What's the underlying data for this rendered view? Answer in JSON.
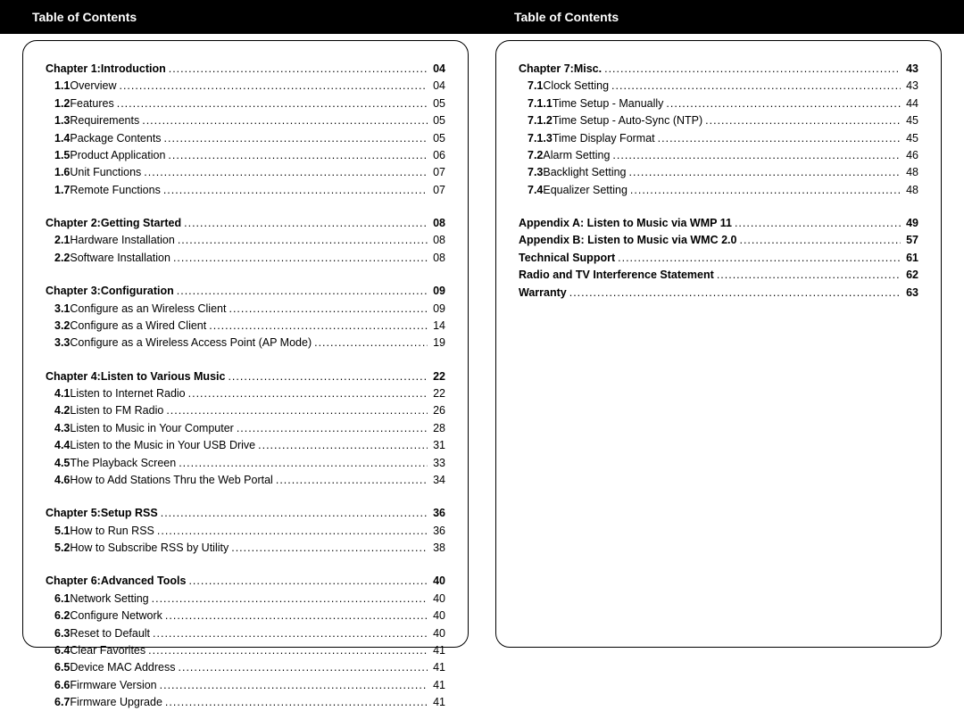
{
  "header_left": "Table of Contents",
  "header_right": "Table of Contents",
  "left_sections": [
    {
      "head": {
        "lead": "Chapter 1:",
        "title": "Introduction",
        "page": "04"
      },
      "rows": [
        {
          "lead": "1.1",
          "title": "Overview",
          "page": "04"
        },
        {
          "lead": "1.2",
          "title": "Features",
          "page": "05"
        },
        {
          "lead": "1.3",
          "title": "Requirements",
          "page": "05"
        },
        {
          "lead": "1.4",
          "title": "Package Contents",
          "page": "05"
        },
        {
          "lead": "1.5",
          "title": "Product Application",
          "page": "06"
        },
        {
          "lead": "1.6",
          "title": "Unit Functions",
          "page": "07"
        },
        {
          "lead": "1.7",
          "title": "Remote Functions",
          "page": "07"
        }
      ]
    },
    {
      "head": {
        "lead": "Chapter 2:",
        "title": "Getting Started",
        "page": "08"
      },
      "rows": [
        {
          "lead": "2.1",
          "title": "Hardware Installation",
          "page": "08"
        },
        {
          "lead": "2.2",
          "title": "Software Installation",
          "page": "08"
        }
      ]
    },
    {
      "head": {
        "lead": "Chapter 3:",
        "title": "Configuration",
        "page": "09"
      },
      "rows": [
        {
          "lead": "3.1",
          "title": "Configure as an Wireless Client",
          "page": "09"
        },
        {
          "lead": "3.2",
          "title": "Configure as a Wired Client",
          "page": "14"
        },
        {
          "lead": "3.3",
          "title": "Configure as a Wireless Access Point (AP Mode)",
          "page": "19"
        }
      ]
    },
    {
      "head": {
        "lead": "Chapter 4:",
        "title": "Listen to Various Music",
        "page": "22"
      },
      "rows": [
        {
          "lead": "4.1",
          "title": "Listen to Internet Radio",
          "page": "22"
        },
        {
          "lead": "4.2",
          "title": "Listen to FM Radio",
          "page": "26"
        },
        {
          "lead": "4.3",
          "title": "Listen to Music in Your Computer",
          "page": "28"
        },
        {
          "lead": "4.4",
          "title": "Listen to the Music in Your USB Drive",
          "page": "31"
        },
        {
          "lead": "4.5",
          "title": "The Playback Screen",
          "page": "33"
        },
        {
          "lead": "4.6",
          "title": "How to Add Stations Thru the Web Portal",
          "page": "34"
        }
      ]
    },
    {
      "head": {
        "lead": "Chapter 5:",
        "title": "Setup RSS",
        "page": "36"
      },
      "rows": [
        {
          "lead": "5.1",
          "title": "How to Run RSS",
          "page": "36"
        },
        {
          "lead": "5.2",
          "title": "How to Subscribe RSS by Utility",
          "page": "38"
        }
      ]
    },
    {
      "head": {
        "lead": "Chapter 6:",
        "title": "Advanced Tools",
        "page": "40"
      },
      "rows": [
        {
          "lead": "6.1",
          "title": "Network Setting",
          "page": "40"
        },
        {
          "lead": "6.2",
          "title": "Configure Network",
          "page": "40"
        },
        {
          "lead": "6.3",
          "title": "Reset to Default",
          "page": "40"
        },
        {
          "lead": "6.4",
          "title": "Clear Favorites",
          "page": "41"
        },
        {
          "lead": "6.5",
          "title": "Device MAC Address",
          "page": "41"
        },
        {
          "lead": "6.6",
          "title": "Firmware Version",
          "page": "41"
        },
        {
          "lead": "6.7",
          "title": "Firmware Upgrade",
          "page": "41"
        }
      ]
    }
  ],
  "right_sections": [
    {
      "head": {
        "lead": "Chapter 7:",
        "title": "Misc.",
        "page": "43"
      },
      "rows": [
        {
          "lead": "7.1",
          "level": 1,
          "title": "Clock Setting",
          "page": "43"
        },
        {
          "lead": "7.1.1",
          "level": 2,
          "title": "Time Setup - Manually",
          "page": "44"
        },
        {
          "lead": "7.1.2",
          "level": 2,
          "title": "Time Setup - Auto-Sync (NTP)",
          "page": "45"
        },
        {
          "lead": "7.1.3",
          "level": 2,
          "title": "Time Display Format",
          "page": "45"
        },
        {
          "lead": "7.2",
          "level": 1,
          "title": "Alarm Setting",
          "page": "46"
        },
        {
          "lead": "7.3",
          "level": 1,
          "title": "Backlight Setting",
          "page": "48"
        },
        {
          "lead": "7.4",
          "level": 1,
          "title": "Equalizer Setting",
          "page": "48"
        }
      ]
    }
  ],
  "right_extras": [
    {
      "title": "Appendix A: Listen to Music via WMP 11",
      "page": "49"
    },
    {
      "title": "Appendix B: Listen to Music via WMC 2.0",
      "page": "57"
    },
    {
      "title": "Technical Support",
      "page": "61"
    },
    {
      "title": "Radio and TV Interference Statement",
      "page": "62"
    },
    {
      "title": "Warranty",
      "page": "63"
    }
  ]
}
